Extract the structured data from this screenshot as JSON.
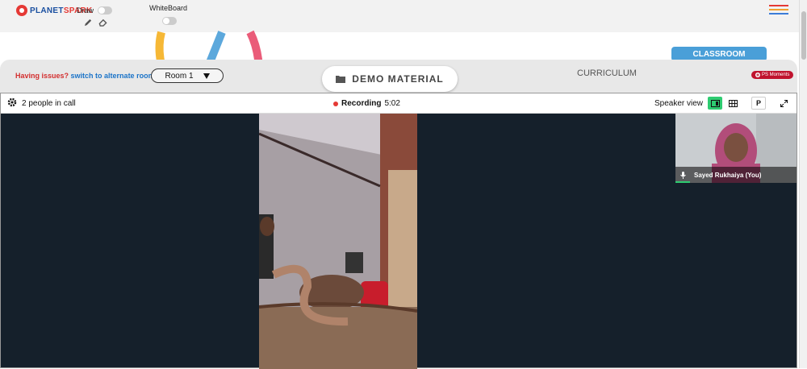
{
  "topbar": {
    "logo_prefix": "PLANET",
    "logo_suffix": "SPARK",
    "draw_label": "Draw",
    "whiteboard_label": "WhiteBoard"
  },
  "room_bar": {
    "issues_text": "Having issues?",
    "switch_text": "switch to alternate room",
    "room_value": "Room 1",
    "demo_material_label": "DEMO MATERIAL",
    "curriculum_label": "CURRICULUM",
    "classroom_label": "CLASSROOM",
    "moments_label": "PS Moments"
  },
  "call": {
    "people_count": "2 people in call",
    "recording_label": "Recording",
    "recording_time": "5:02",
    "view_label": "Speaker view",
    "presenter_button": "P",
    "self_name": "Sayed Rukhaiya (You)"
  },
  "colors": {
    "accent_red": "#e53935",
    "tab_blue": "#4a9fd8",
    "issues_red": "#d32f2f",
    "switch_blue": "#1a73c8",
    "speaker_active": "#2ecc71"
  },
  "icons": [
    "pencil-icon",
    "eraser-icon",
    "hamburger-menu-icon",
    "folder-icon",
    "dropdown-arrow-icon",
    "gear-icon",
    "recording-dot-icon",
    "speaker-view-icon",
    "grid-view-icon",
    "fullscreen-icon",
    "microphone-icon"
  ]
}
